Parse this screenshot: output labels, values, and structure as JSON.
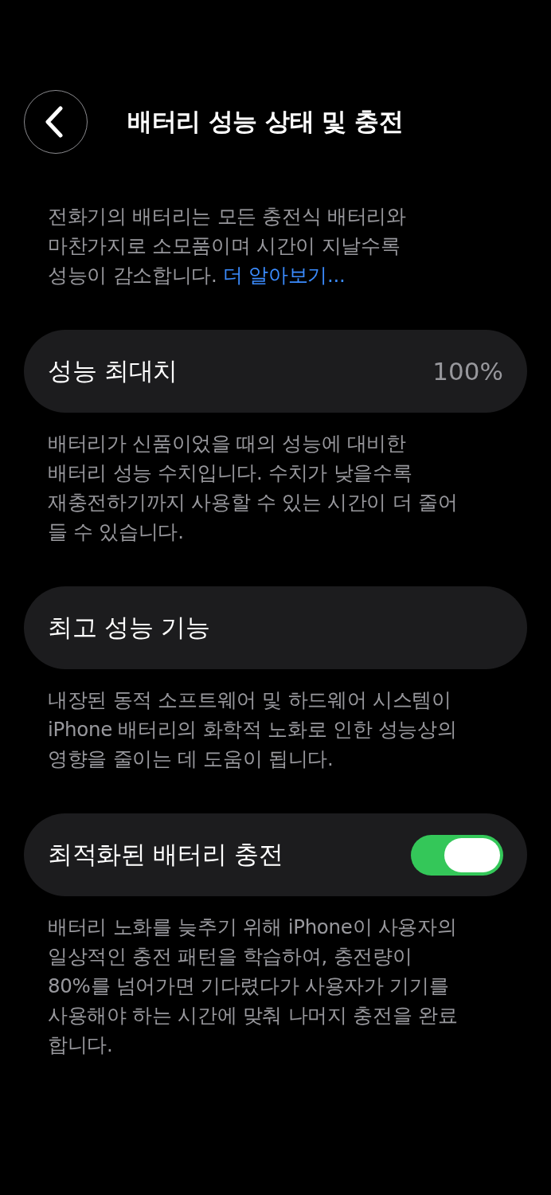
{
  "header": {
    "title": "배터리 성능 상태 및 충전"
  },
  "intro": {
    "text": "전화기의 배터리는 모든 충전식 배터리와\n마찬가지로 소모품이며 시간이 지날수록\n성능이 감소합니다.",
    "link": "더 알아보기..."
  },
  "sections": [
    {
      "kind": "value",
      "label": "성능 최대치",
      "value": "100%",
      "footer": "배터리가 신품이었을 때의 성능에 대비한\n배터리 성능 수치입니다. 수치가 낮을수록\n재충전하기까지 사용할 수 있는 시간이 더 줄어\n들 수 있습니다."
    },
    {
      "kind": "plain",
      "label": "최고 성능 기능",
      "footer": "내장된 동적 소프트웨어 및 하드웨어 시스템이\niPhone 배터리의 화학적 노화로 인한 성능상의\n영향을 줄이는 데 도움이 됩니다."
    },
    {
      "kind": "toggle",
      "label": "최적화된 배터리 충전",
      "on": true,
      "footer": "배터리 노화를 늦추기 위해 iPhone이 사용자의\n일상적인 충전 패턴을 학습하여, 충전량이\n80%를 넘어가면 기다렸다가 사용자가 기기를\n사용해야 하는 시간에 맞춰 나머지 충전을 완료\n합니다."
    }
  ]
}
